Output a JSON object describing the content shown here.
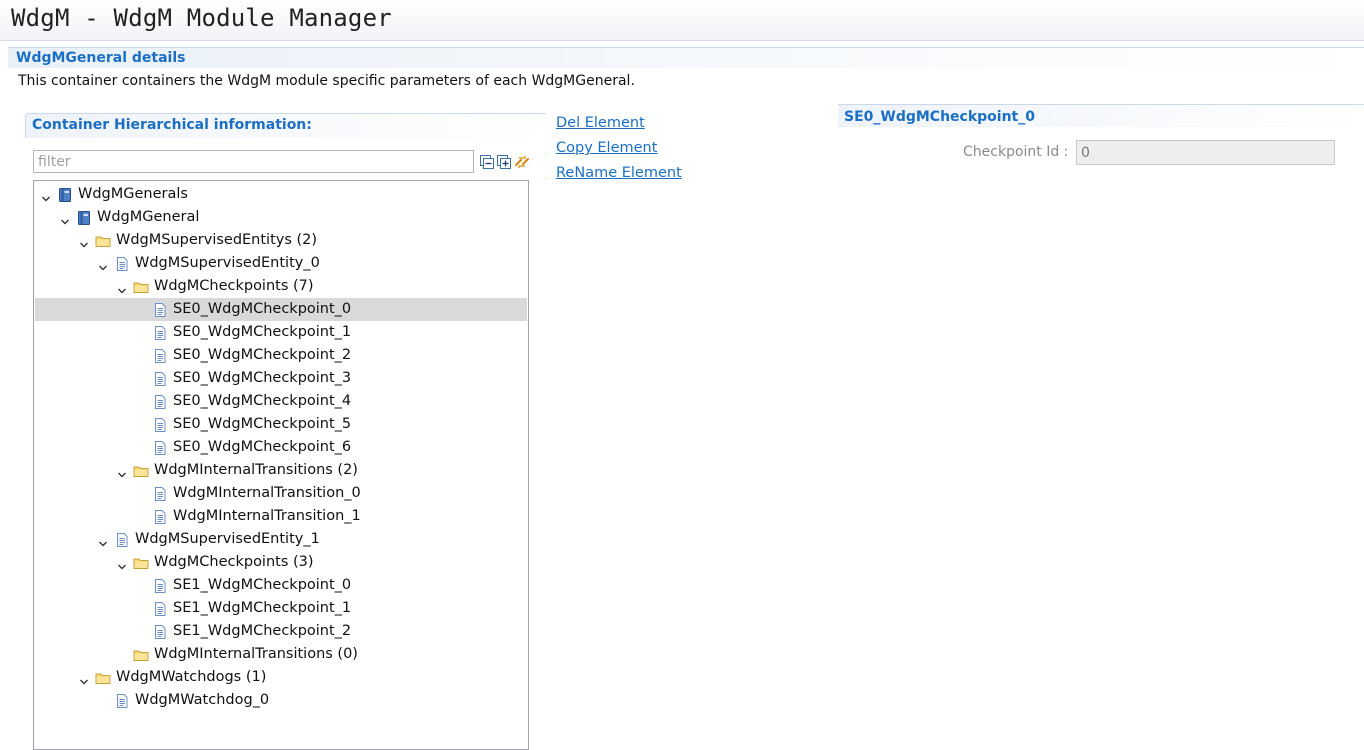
{
  "window": {
    "title": "WdgM - WdgM Module Manager"
  },
  "section": {
    "title": "WdgMGeneral details",
    "description": "This container containers the WdgM module specific parameters of each WdgMGeneral."
  },
  "hierarchy": {
    "title": "Container Hierarchical information:",
    "filter_placeholder": "filter",
    "toolbar": [
      "collapse-all-icon",
      "expand-all-icon",
      "link-sync-icon"
    ]
  },
  "tree": [
    {
      "label": "WdgMGenerals",
      "depth": 0,
      "icon": "module-icon",
      "expanded": true
    },
    {
      "label": "WdgMGeneral",
      "depth": 1,
      "icon": "module-icon",
      "expanded": true
    },
    {
      "label": "WdgMSupervisedEntitys (2)",
      "depth": 2,
      "icon": "folder-icon",
      "expanded": true
    },
    {
      "label": "WdgMSupervisedEntity_0",
      "depth": 3,
      "icon": "document-icon",
      "expanded": true
    },
    {
      "label": "WdgMCheckpoints (7)",
      "depth": 4,
      "icon": "folder-icon",
      "expanded": true
    },
    {
      "label": "SE0_WdgMCheckpoint_0",
      "depth": 5,
      "icon": "document-icon",
      "selected": true
    },
    {
      "label": "SE0_WdgMCheckpoint_1",
      "depth": 5,
      "icon": "document-icon"
    },
    {
      "label": "SE0_WdgMCheckpoint_2",
      "depth": 5,
      "icon": "document-icon"
    },
    {
      "label": "SE0_WdgMCheckpoint_3",
      "depth": 5,
      "icon": "document-icon"
    },
    {
      "label": "SE0_WdgMCheckpoint_4",
      "depth": 5,
      "icon": "document-icon"
    },
    {
      "label": "SE0_WdgMCheckpoint_5",
      "depth": 5,
      "icon": "document-icon"
    },
    {
      "label": "SE0_WdgMCheckpoint_6",
      "depth": 5,
      "icon": "document-icon"
    },
    {
      "label": "WdgMInternalTransitions (2)",
      "depth": 4,
      "icon": "folder-icon",
      "expanded": true
    },
    {
      "label": "WdgMInternalTransition_0",
      "depth": 5,
      "icon": "document-icon"
    },
    {
      "label": "WdgMInternalTransition_1",
      "depth": 5,
      "icon": "document-icon"
    },
    {
      "label": "WdgMSupervisedEntity_1",
      "depth": 3,
      "icon": "document-icon",
      "expanded": true
    },
    {
      "label": "WdgMCheckpoints (3)",
      "depth": 4,
      "icon": "folder-icon",
      "expanded": true
    },
    {
      "label": "SE1_WdgMCheckpoint_0",
      "depth": 5,
      "icon": "document-icon"
    },
    {
      "label": "SE1_WdgMCheckpoint_1",
      "depth": 5,
      "icon": "document-icon"
    },
    {
      "label": "SE1_WdgMCheckpoint_2",
      "depth": 5,
      "icon": "document-icon"
    },
    {
      "label": "WdgMInternalTransitions (0)",
      "depth": 4,
      "icon": "folder-icon"
    },
    {
      "label": "WdgMWatchdogs (1)",
      "depth": 2,
      "icon": "folder-icon",
      "expanded": true
    },
    {
      "label": "WdgMWatchdog_0",
      "depth": 3,
      "icon": "document-icon"
    }
  ],
  "actions": {
    "delete": "Del Element",
    "copy": "Copy Element",
    "rename": "ReName Element"
  },
  "detail": {
    "title": "SE0_WdgMCheckpoint_0",
    "checkpoint_id_label": "Checkpoint Id :",
    "checkpoint_id_value": "0"
  },
  "colors": {
    "accent": "#1a6fc4",
    "selection": "#d9d9d9",
    "folder": "#f2c744",
    "module": "#3e6fb3"
  }
}
